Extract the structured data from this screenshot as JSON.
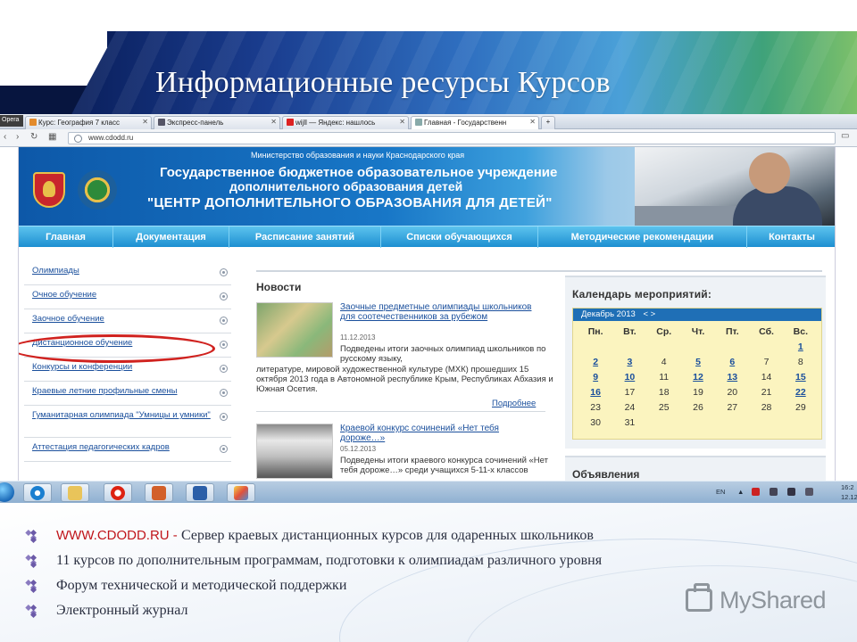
{
  "slide": {
    "title": "Информационные ресурсы Курсов"
  },
  "browser": {
    "opera_label": "Opera",
    "tabs": [
      {
        "label": "Курс: География 7 класс",
        "icon": "course-icon"
      },
      {
        "label": "Экспресс-панель",
        "icon": "grid-icon"
      },
      {
        "label": "wijll — Яндекс: нашлось",
        "icon": "yandex-icon"
      },
      {
        "label": "Главная - Государственн",
        "icon": "page-icon",
        "active": true
      }
    ],
    "url": "www.cdodd.ru"
  },
  "site": {
    "ministry": "Министерство образования и науки Краснодарского края",
    "org_line1": "Государственное бюджетное образовательное учреждение",
    "org_line2": "дополнительного образования детей",
    "org_name": "\"ЦЕНТР ДОПОЛНИТЕЛЬНОГО ОБРАЗОВАНИЯ ДЛЯ ДЕТЕЙ\"",
    "menu": [
      "Главная",
      "Документация",
      "Расписание занятий",
      "Списки обучающихся",
      "Методические рекомендации",
      "Контакты"
    ],
    "sidebar": [
      "Олимпиады",
      "Очное обучение",
      "Заочное обучение",
      "Дистанционное обучение",
      "Конкурсы и конференции",
      "Краевые летние профильные смены",
      "Гуманитарная олимпиада \"Умницы и умники\"",
      "Аттестация педагогических кадров"
    ],
    "news": {
      "title": "Новости",
      "items": [
        {
          "link": "Заочные предметные олимпиады школьников для соотечественников за рубежом",
          "date": "11.12.2013",
          "text1": "Подведены итоги заочных олимпиад школьников по русскому языку,",
          "text2": "литературе, мировой художественной культуре (МХК) прошедших 15 октября 2013 года в Автономной республике Крым, Республиках Абхазия и Южная Осетия."
        },
        {
          "link": "Краевой конкурс сочинений «Нет тебя дороже…»",
          "date": "05.12.2013",
          "text1": "Подведены итоги краевого конкурса сочинений «Нет тебя дороже…» среди учащихся 5-11-х классов"
        }
      ],
      "more": "Подробнее"
    },
    "calendar": {
      "title": "Календарь мероприятий:",
      "month": "Декабрь 2013",
      "nav": "< >",
      "weekdays": [
        "Пн.",
        "Вт.",
        "Ср.",
        "Чт.",
        "Пт.",
        "Сб.",
        "Вс."
      ],
      "days": [
        "",
        "",
        "",
        "",
        "",
        "",
        "1",
        "2",
        "3",
        "4",
        "5",
        "6",
        "7",
        "8",
        "9",
        "10",
        "11",
        "12",
        "13",
        "14",
        "15",
        "16",
        "17",
        "18",
        "19",
        "20",
        "21",
        "22",
        "23",
        "24",
        "25",
        "26",
        "27",
        "28",
        "29",
        "30",
        "31",
        "",
        "",
        "",
        "",
        ""
      ],
      "event_days": [
        "1",
        "2",
        "3",
        "5",
        "6",
        "9",
        "10",
        "12",
        "13",
        "15",
        "16",
        "22"
      ]
    },
    "ads_title": "Объявления"
  },
  "taskbar": {
    "apps": [
      "ie-icon",
      "explorer-icon",
      "opera-icon",
      "powerpoint-icon",
      "word-icon",
      "paint-icon"
    ],
    "lang": "EN",
    "time": "16:2",
    "date": "12.12.2"
  },
  "bullets": {
    "row1_url": "WWW.CDODD.RU - ",
    "row1_text": "Сервер краевых дистанционных курсов для одаренных школьников",
    "row2": "11 курсов по дополнительным программам, подготовки к олимпиадам различного уровня",
    "row3": "Форум технической и методической поддержки",
    "row4": "Электронный журнал"
  },
  "watermark": "MyShared"
}
